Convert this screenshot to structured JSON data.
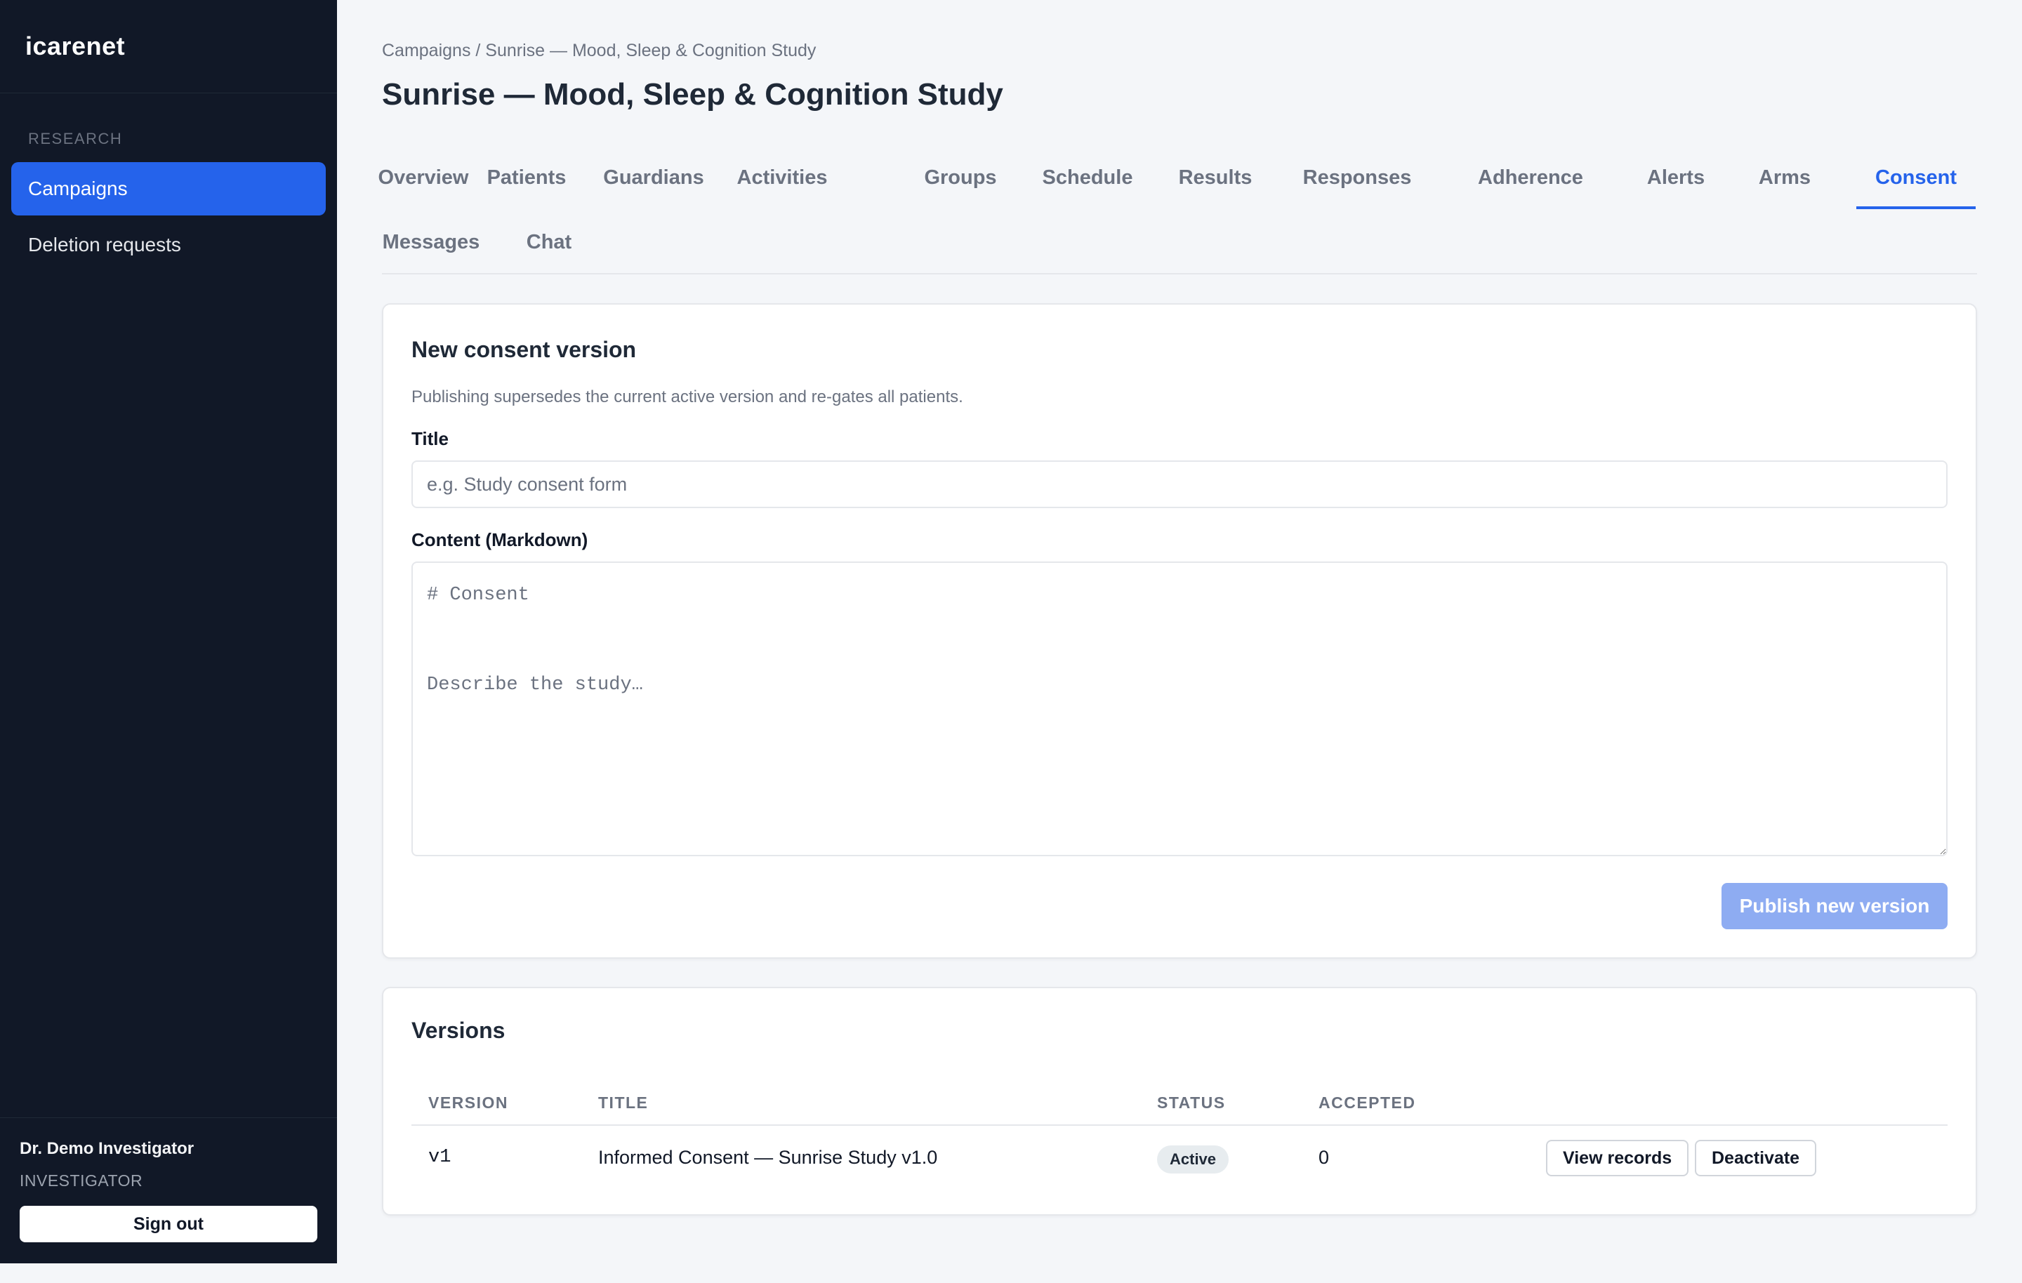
{
  "brand": "icarenet",
  "sidebar": {
    "section_label": "RESEARCH",
    "items": [
      {
        "label": "Campaigns",
        "active": true
      },
      {
        "label": "Deletion requests",
        "active": false
      }
    ],
    "user": {
      "name": "Dr. Demo Investigator",
      "role": "INVESTIGATOR"
    },
    "sign_out_label": "Sign out"
  },
  "header": {
    "breadcrumb": "Campaigns / Sunrise — Mood, Sleep & Cognition Study",
    "title": "Sunrise — Mood, Sleep & Cognition Study"
  },
  "tabs": [
    {
      "label": "Overview"
    },
    {
      "label": "Patients"
    },
    {
      "label": "Guardians"
    },
    {
      "label": "Activities"
    },
    {
      "label": "Groups"
    },
    {
      "label": "Schedule"
    },
    {
      "label": "Results"
    },
    {
      "label": "Responses"
    },
    {
      "label": "Adherence"
    },
    {
      "label": "Alerts"
    },
    {
      "label": "Arms"
    },
    {
      "label": "Consent",
      "active": true
    },
    {
      "label": "Messages"
    },
    {
      "label": "Chat"
    }
  ],
  "new_consent": {
    "heading": "New consent version",
    "description": "Publishing supersedes the current active version and re-gates all patients.",
    "title_label": "Title",
    "title_value": "",
    "title_placeholder": "e.g. Study consent form",
    "content_label": "Content (Markdown)",
    "content_value": "",
    "content_placeholder": "# Consent\n\nDescribe the study…",
    "publish_label": "Publish new version"
  },
  "versions": {
    "heading": "Versions",
    "columns": [
      "VERSION",
      "TITLE",
      "STATUS",
      "ACCEPTED"
    ],
    "rows": [
      {
        "version": "v1",
        "title": "Informed Consent — Sunrise Study v1.0",
        "status": "Active",
        "accepted": "0",
        "actions": [
          "View records",
          "Deactivate"
        ]
      }
    ]
  },
  "colors": {
    "sidebar_bg": "#111827",
    "accent": "#2563eb",
    "publish_disabled": "#8eacf2",
    "page_bg": "#f4f6f9"
  }
}
